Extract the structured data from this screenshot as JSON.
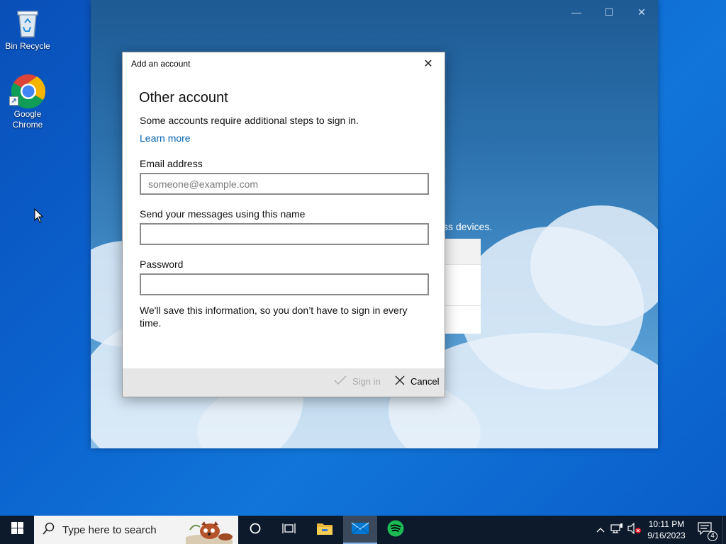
{
  "desktop": {
    "icons": [
      {
        "label": "Bin Recycle",
        "icon": "recycle-bin-icon"
      },
      {
        "label": "Google Chrome",
        "icon": "chrome-icon"
      }
    ]
  },
  "app_window": {
    "background_text": "ss devices.",
    "controls": {
      "minimize": "—",
      "maximize": "☐",
      "close": "✕"
    }
  },
  "dialog": {
    "title": "Add an account",
    "close_glyph": "✕",
    "heading": "Other account",
    "description": "Some accounts require additional steps to sign in.",
    "learn_more": "Learn more",
    "email": {
      "label": "Email address",
      "placeholder": "someone@example.com",
      "value": ""
    },
    "name": {
      "label": "Send your messages using this name",
      "value": ""
    },
    "password": {
      "label": "Password",
      "value": ""
    },
    "note": "We'll save this information, so you don’t have to sign in every time.",
    "sign_in_label": "Sign in",
    "cancel_label": "Cancel"
  },
  "taskbar": {
    "search_placeholder": "Type here to search",
    "apps": [
      "cortana-icon",
      "task-view-icon",
      "file-explorer-icon",
      "mail-icon",
      "spotify-icon"
    ],
    "active_app": "mail-icon",
    "clock": {
      "time": "10:11 PM",
      "date": "9/16/2023"
    },
    "notification_count": "4"
  },
  "colors": {
    "accent": "#0063b1",
    "taskbar": "#0c1a2c",
    "desktop": "#0b63cf",
    "spotify": "#1db954",
    "mail": "#0078d4"
  }
}
